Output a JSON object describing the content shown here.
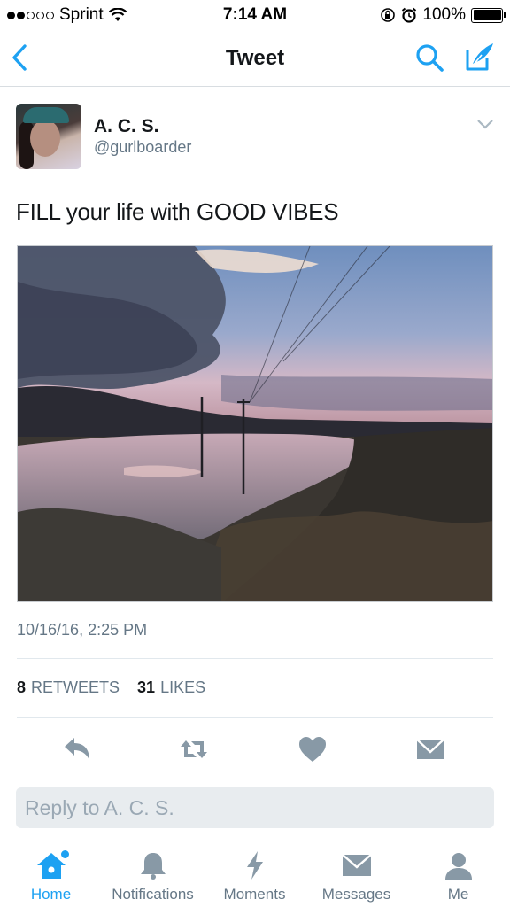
{
  "status_bar": {
    "carrier": "Sprint",
    "time": "7:14 AM",
    "battery": "100%"
  },
  "nav": {
    "title": "Tweet"
  },
  "tweet": {
    "author_name": "A. C. S.",
    "author_handle": "@gurlboarder",
    "text": "FILL your life with GOOD VIBES",
    "timestamp": "10/16/16, 2:25 PM",
    "retweets_count": "8",
    "retweets_label": "RETWEETS",
    "likes_count": "31",
    "likes_label": "LIKES"
  },
  "reply": {
    "placeholder": "Reply to A. C. S."
  },
  "tabs": [
    {
      "label": "Home",
      "icon": "home-icon",
      "active": true
    },
    {
      "label": "Notifications",
      "icon": "bell-icon",
      "active": false
    },
    {
      "label": "Moments",
      "icon": "lightning-icon",
      "active": false
    },
    {
      "label": "Messages",
      "icon": "envelope-icon",
      "active": false
    },
    {
      "label": "Me",
      "icon": "person-icon",
      "active": false
    }
  ],
  "colors": {
    "accent": "#1da1f2",
    "secondary_text": "#657786",
    "action_icon": "#8899a6"
  }
}
